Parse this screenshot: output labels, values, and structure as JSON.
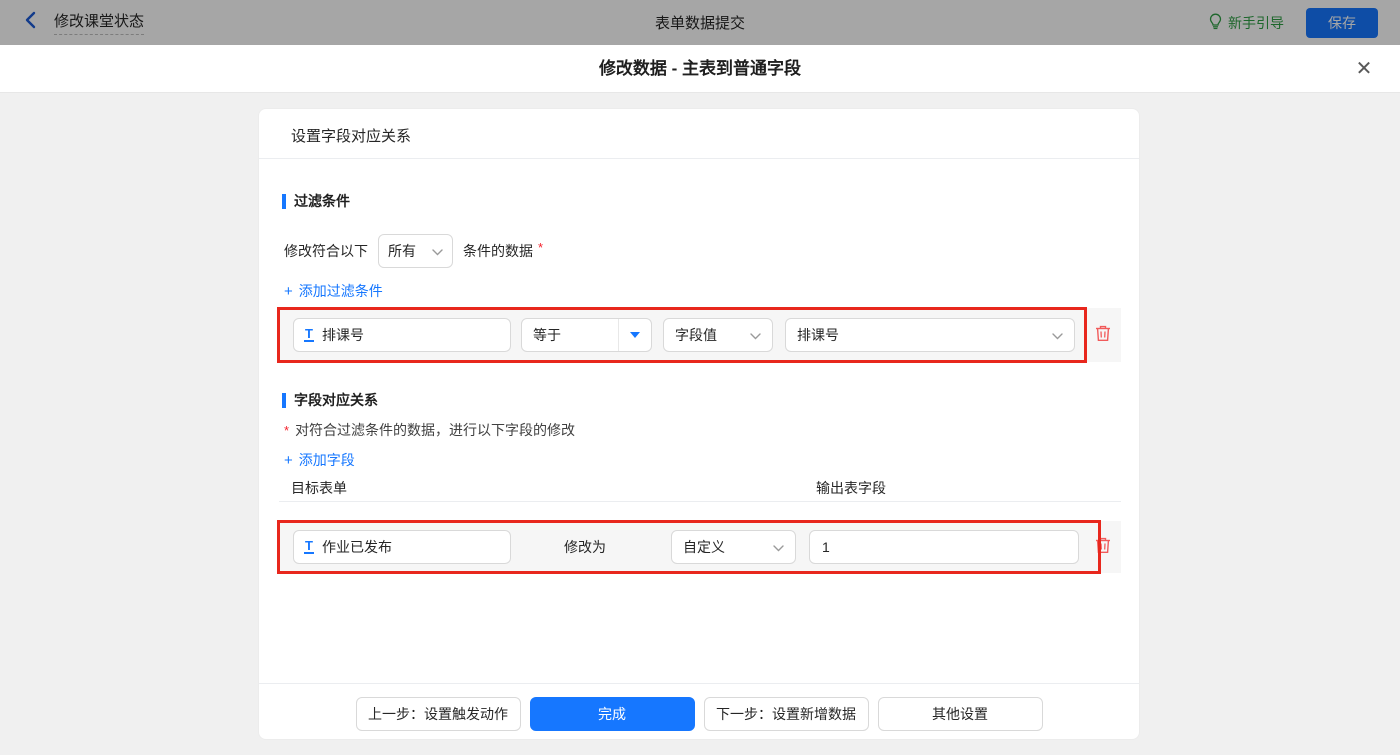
{
  "topbar": {
    "back_label": "修改课堂状态",
    "center_title": "表单数据提交",
    "guide_label": "新手引导",
    "save_label": "保存"
  },
  "modal": {
    "title": "修改数据 - 主表到普通字段"
  },
  "icons": {
    "plus": "+",
    "close": "✕"
  },
  "card": {
    "header": "设置字段对应关系",
    "filter_section": {
      "title": "过滤条件",
      "cond_prefix": "修改符合以下",
      "match_select_value": "所有",
      "cond_suffix": "条件的数据",
      "required_mark": "*",
      "add_label": "添加过滤条件",
      "row": {
        "field": "排课号",
        "operator": "等于",
        "value_type": "字段值",
        "value_field": "排课号"
      }
    },
    "mapping_section": {
      "title": "字段对应关系",
      "required_mark": "*",
      "note": "对符合过滤条件的数据，进行以下字段的修改",
      "add_label": "添加字段",
      "col_target": "目标表单",
      "col_output": "输出表字段",
      "row": {
        "field": "作业已发布",
        "modify_label": "修改为",
        "mode": "自定义",
        "value": "1"
      }
    },
    "footer": {
      "prev": "上一步：设置触发动作",
      "done": "完成",
      "next": "下一步：设置新增数据",
      "other": "其他设置"
    }
  },
  "colors": {
    "accent": "#1677ff",
    "highlight_red": "#e8271d",
    "trash_red": "#f15b5b",
    "guide_green": "#2e9e44"
  }
}
